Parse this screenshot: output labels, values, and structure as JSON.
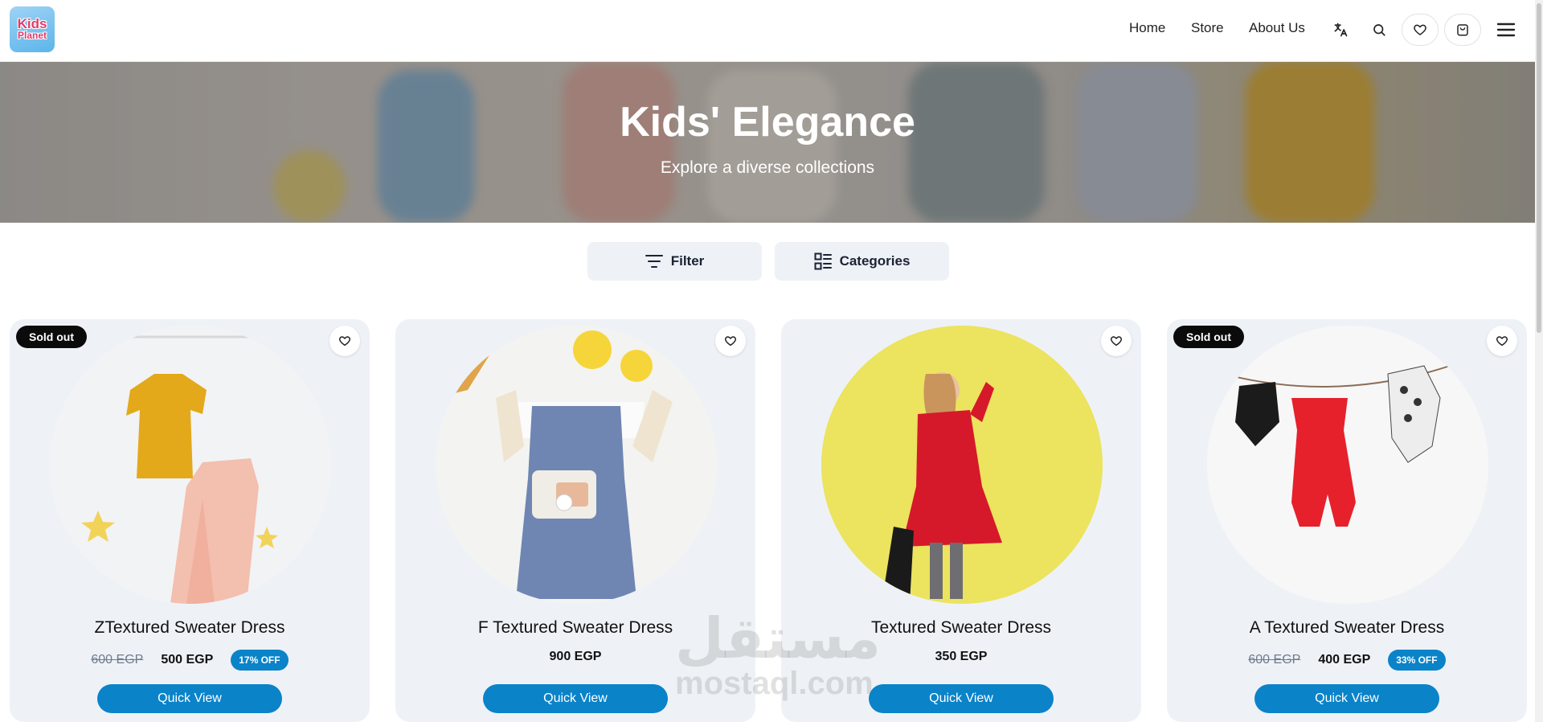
{
  "header": {
    "logo_line1": "Kids",
    "logo_line2": "Planet",
    "nav": [
      {
        "label": "Home"
      },
      {
        "label": "Store"
      },
      {
        "label": "About Us"
      }
    ],
    "icons": [
      "translate-icon",
      "search-icon",
      "heart-icon",
      "cart-icon",
      "menu-icon"
    ]
  },
  "hero": {
    "title": "Kids' Elegance",
    "subtitle": "Explore a diverse collections"
  },
  "toolbar": {
    "filter_label": "Filter",
    "categories_label": "Categories"
  },
  "products": [
    {
      "title": "ZTextured Sweater Dress",
      "old_price": "600 EGP",
      "price": "500 EGP",
      "discount": "17% OFF",
      "sold_out": "Sold out",
      "button": "Quick View"
    },
    {
      "title": "F Textured Sweater Dress",
      "price": "900 EGP",
      "button": "Quick View"
    },
    {
      "title": "Textured Sweater Dress",
      "price": "350 EGP",
      "button": "Quick View"
    },
    {
      "title": "A Textured Sweater Dress",
      "old_price": "600 EGP",
      "price": "400 EGP",
      "discount": "33% OFF",
      "sold_out": "Sold out",
      "button": "Quick View"
    }
  ],
  "watermark": {
    "arabic": "مستقل",
    "latin": "mostaql.com"
  },
  "colors": {
    "accent": "#0a83c9",
    "card_bg": "#eef2f7",
    "badge": "#0b0b0b"
  }
}
